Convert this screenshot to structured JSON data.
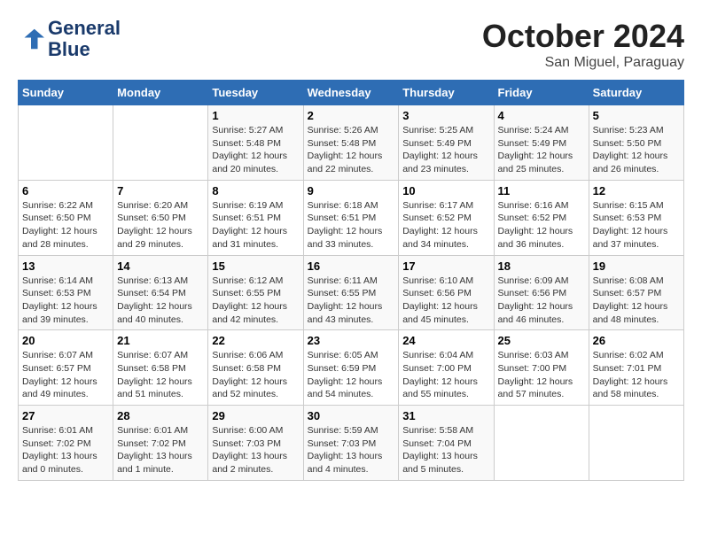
{
  "header": {
    "logo_line1": "General",
    "logo_line2": "Blue",
    "month_year": "October 2024",
    "location": "San Miguel, Paraguay"
  },
  "weekdays": [
    "Sunday",
    "Monday",
    "Tuesday",
    "Wednesday",
    "Thursday",
    "Friday",
    "Saturday"
  ],
  "weeks": [
    [
      {
        "day": "",
        "sunrise": "",
        "sunset": "",
        "daylight": ""
      },
      {
        "day": "",
        "sunrise": "",
        "sunset": "",
        "daylight": ""
      },
      {
        "day": "1",
        "sunrise": "Sunrise: 5:27 AM",
        "sunset": "Sunset: 5:48 PM",
        "daylight": "Daylight: 12 hours and 20 minutes."
      },
      {
        "day": "2",
        "sunrise": "Sunrise: 5:26 AM",
        "sunset": "Sunset: 5:48 PM",
        "daylight": "Daylight: 12 hours and 22 minutes."
      },
      {
        "day": "3",
        "sunrise": "Sunrise: 5:25 AM",
        "sunset": "Sunset: 5:49 PM",
        "daylight": "Daylight: 12 hours and 23 minutes."
      },
      {
        "day": "4",
        "sunrise": "Sunrise: 5:24 AM",
        "sunset": "Sunset: 5:49 PM",
        "daylight": "Daylight: 12 hours and 25 minutes."
      },
      {
        "day": "5",
        "sunrise": "Sunrise: 5:23 AM",
        "sunset": "Sunset: 5:50 PM",
        "daylight": "Daylight: 12 hours and 26 minutes."
      }
    ],
    [
      {
        "day": "6",
        "sunrise": "Sunrise: 6:22 AM",
        "sunset": "Sunset: 6:50 PM",
        "daylight": "Daylight: 12 hours and 28 minutes."
      },
      {
        "day": "7",
        "sunrise": "Sunrise: 6:20 AM",
        "sunset": "Sunset: 6:50 PM",
        "daylight": "Daylight: 12 hours and 29 minutes."
      },
      {
        "day": "8",
        "sunrise": "Sunrise: 6:19 AM",
        "sunset": "Sunset: 6:51 PM",
        "daylight": "Daylight: 12 hours and 31 minutes."
      },
      {
        "day": "9",
        "sunrise": "Sunrise: 6:18 AM",
        "sunset": "Sunset: 6:51 PM",
        "daylight": "Daylight: 12 hours and 33 minutes."
      },
      {
        "day": "10",
        "sunrise": "Sunrise: 6:17 AM",
        "sunset": "Sunset: 6:52 PM",
        "daylight": "Daylight: 12 hours and 34 minutes."
      },
      {
        "day": "11",
        "sunrise": "Sunrise: 6:16 AM",
        "sunset": "Sunset: 6:52 PM",
        "daylight": "Daylight: 12 hours and 36 minutes."
      },
      {
        "day": "12",
        "sunrise": "Sunrise: 6:15 AM",
        "sunset": "Sunset: 6:53 PM",
        "daylight": "Daylight: 12 hours and 37 minutes."
      }
    ],
    [
      {
        "day": "13",
        "sunrise": "Sunrise: 6:14 AM",
        "sunset": "Sunset: 6:53 PM",
        "daylight": "Daylight: 12 hours and 39 minutes."
      },
      {
        "day": "14",
        "sunrise": "Sunrise: 6:13 AM",
        "sunset": "Sunset: 6:54 PM",
        "daylight": "Daylight: 12 hours and 40 minutes."
      },
      {
        "day": "15",
        "sunrise": "Sunrise: 6:12 AM",
        "sunset": "Sunset: 6:55 PM",
        "daylight": "Daylight: 12 hours and 42 minutes."
      },
      {
        "day": "16",
        "sunrise": "Sunrise: 6:11 AM",
        "sunset": "Sunset: 6:55 PM",
        "daylight": "Daylight: 12 hours and 43 minutes."
      },
      {
        "day": "17",
        "sunrise": "Sunrise: 6:10 AM",
        "sunset": "Sunset: 6:56 PM",
        "daylight": "Daylight: 12 hours and 45 minutes."
      },
      {
        "day": "18",
        "sunrise": "Sunrise: 6:09 AM",
        "sunset": "Sunset: 6:56 PM",
        "daylight": "Daylight: 12 hours and 46 minutes."
      },
      {
        "day": "19",
        "sunrise": "Sunrise: 6:08 AM",
        "sunset": "Sunset: 6:57 PM",
        "daylight": "Daylight: 12 hours and 48 minutes."
      }
    ],
    [
      {
        "day": "20",
        "sunrise": "Sunrise: 6:07 AM",
        "sunset": "Sunset: 6:57 PM",
        "daylight": "Daylight: 12 hours and 49 minutes."
      },
      {
        "day": "21",
        "sunrise": "Sunrise: 6:07 AM",
        "sunset": "Sunset: 6:58 PM",
        "daylight": "Daylight: 12 hours and 51 minutes."
      },
      {
        "day": "22",
        "sunrise": "Sunrise: 6:06 AM",
        "sunset": "Sunset: 6:58 PM",
        "daylight": "Daylight: 12 hours and 52 minutes."
      },
      {
        "day": "23",
        "sunrise": "Sunrise: 6:05 AM",
        "sunset": "Sunset: 6:59 PM",
        "daylight": "Daylight: 12 hours and 54 minutes."
      },
      {
        "day": "24",
        "sunrise": "Sunrise: 6:04 AM",
        "sunset": "Sunset: 7:00 PM",
        "daylight": "Daylight: 12 hours and 55 minutes."
      },
      {
        "day": "25",
        "sunrise": "Sunrise: 6:03 AM",
        "sunset": "Sunset: 7:00 PM",
        "daylight": "Daylight: 12 hours and 57 minutes."
      },
      {
        "day": "26",
        "sunrise": "Sunrise: 6:02 AM",
        "sunset": "Sunset: 7:01 PM",
        "daylight": "Daylight: 12 hours and 58 minutes."
      }
    ],
    [
      {
        "day": "27",
        "sunrise": "Sunrise: 6:01 AM",
        "sunset": "Sunset: 7:02 PM",
        "daylight": "Daylight: 13 hours and 0 minutes."
      },
      {
        "day": "28",
        "sunrise": "Sunrise: 6:01 AM",
        "sunset": "Sunset: 7:02 PM",
        "daylight": "Daylight: 13 hours and 1 minute."
      },
      {
        "day": "29",
        "sunrise": "Sunrise: 6:00 AM",
        "sunset": "Sunset: 7:03 PM",
        "daylight": "Daylight: 13 hours and 2 minutes."
      },
      {
        "day": "30",
        "sunrise": "Sunrise: 5:59 AM",
        "sunset": "Sunset: 7:03 PM",
        "daylight": "Daylight: 13 hours and 4 minutes."
      },
      {
        "day": "31",
        "sunrise": "Sunrise: 5:58 AM",
        "sunset": "Sunset: 7:04 PM",
        "daylight": "Daylight: 13 hours and 5 minutes."
      },
      {
        "day": "",
        "sunrise": "",
        "sunset": "",
        "daylight": ""
      },
      {
        "day": "",
        "sunrise": "",
        "sunset": "",
        "daylight": ""
      }
    ]
  ]
}
